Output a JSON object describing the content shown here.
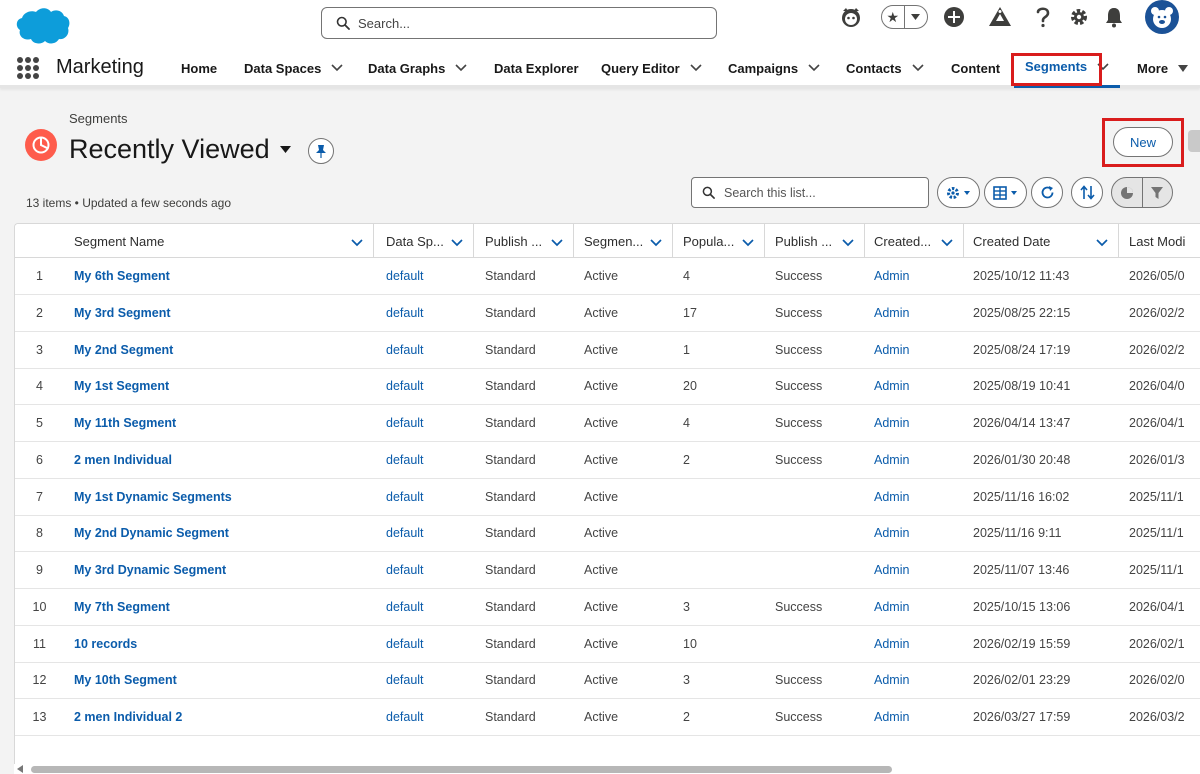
{
  "global": {
    "search_placeholder": "Search..."
  },
  "nav": {
    "app_name": "Marketing",
    "items": [
      {
        "label": "Home",
        "chevron": false
      },
      {
        "label": "Data Spaces",
        "chevron": true
      },
      {
        "label": "Data Graphs",
        "chevron": true
      },
      {
        "label": "Data Explorer",
        "chevron": false
      },
      {
        "label": "Query Editor",
        "chevron": true
      },
      {
        "label": "Campaigns",
        "chevron": true
      },
      {
        "label": "Contacts",
        "chevron": true
      },
      {
        "label": "Content",
        "chevron": false
      },
      {
        "label": "Segments",
        "chevron": true,
        "active": true
      },
      {
        "label": "More",
        "chevron": true
      }
    ]
  },
  "page": {
    "object_label": "Segments",
    "list_title": "Recently Viewed",
    "new_label": "New",
    "meta": "13 items • Updated a few seconds ago",
    "search_placeholder": "Search this list..."
  },
  "table": {
    "headers": [
      "Segment Name",
      "Data Sp...",
      "Publish ...",
      "Segmen...",
      "Popula...",
      "Publish ...",
      "Created...",
      "Created Date",
      "Last Modi"
    ],
    "rows": [
      {
        "n": "1",
        "name": "My 6th Segment",
        "space": "default",
        "publish_type": "Standard",
        "status": "Active",
        "population": "4",
        "publish_status": "Success",
        "created_by": "Admin",
        "created_date": "2025/10/12 11:43",
        "last_modified": "2026/05/0"
      },
      {
        "n": "2",
        "name": "My 3rd Segment",
        "space": "default",
        "publish_type": "Standard",
        "status": "Active",
        "population": "17",
        "publish_status": "Success",
        "created_by": "Admin",
        "created_date": "2025/08/25 22:15",
        "last_modified": "2026/02/2"
      },
      {
        "n": "3",
        "name": "My 2nd Segment",
        "space": "default",
        "publish_type": "Standard",
        "status": "Active",
        "population": "1",
        "publish_status": "Success",
        "created_by": "Admin",
        "created_date": "2025/08/24 17:19",
        "last_modified": "2026/02/2"
      },
      {
        "n": "4",
        "name": "My 1st Segment",
        "space": "default",
        "publish_type": "Standard",
        "status": "Active",
        "population": "20",
        "publish_status": "Success",
        "created_by": "Admin",
        "created_date": "2025/08/19 10:41",
        "last_modified": "2026/04/0"
      },
      {
        "n": "5",
        "name": "My 11th Segment",
        "space": "default",
        "publish_type": "Standard",
        "status": "Active",
        "population": "4",
        "publish_status": "Success",
        "created_by": "Admin",
        "created_date": "2026/04/14 13:47",
        "last_modified": "2026/04/1"
      },
      {
        "n": "6",
        "name": "2 men Individual",
        "space": "default",
        "publish_type": "Standard",
        "status": "Active",
        "population": "2",
        "publish_status": "Success",
        "created_by": "Admin",
        "created_date": "2026/01/30 20:48",
        "last_modified": "2026/01/3"
      },
      {
        "n": "7",
        "name": "My 1st Dynamic Segments",
        "space": "default",
        "publish_type": "Standard",
        "status": "Active",
        "population": "",
        "publish_status": "",
        "created_by": "Admin",
        "created_date": "2025/11/16 16:02",
        "last_modified": "2025/11/1"
      },
      {
        "n": "8",
        "name": "My 2nd Dynamic Segment",
        "space": "default",
        "publish_type": "Standard",
        "status": "Active",
        "population": "",
        "publish_status": "",
        "created_by": "Admin",
        "created_date": "2025/11/16 9:11",
        "last_modified": "2025/11/1"
      },
      {
        "n": "9",
        "name": "My 3rd Dynamic Segment",
        "space": "default",
        "publish_type": "Standard",
        "status": "Active",
        "population": "",
        "publish_status": "",
        "created_by": "Admin",
        "created_date": "2025/11/07 13:46",
        "last_modified": "2025/11/1"
      },
      {
        "n": "10",
        "name": "My 7th Segment",
        "space": "default",
        "publish_type": "Standard",
        "status": "Active",
        "population": "3",
        "publish_status": "Success",
        "created_by": "Admin",
        "created_date": "2025/10/15 13:06",
        "last_modified": "2026/04/1"
      },
      {
        "n": "11",
        "name": "10 records",
        "space": "default",
        "publish_type": "Standard",
        "status": "Active",
        "population": "10",
        "publish_status": "",
        "created_by": "Admin",
        "created_date": "2026/02/19 15:59",
        "last_modified": "2026/02/1"
      },
      {
        "n": "12",
        "name": "My 10th Segment",
        "space": "default",
        "publish_type": "Standard",
        "status": "Active",
        "population": "3",
        "publish_status": "Success",
        "created_by": "Admin",
        "created_date": "2026/02/01 23:29",
        "last_modified": "2026/02/0"
      },
      {
        "n": "13",
        "name": "2 men Individual 2",
        "space": "default",
        "publish_type": "Standard",
        "status": "Active",
        "population": "2",
        "publish_status": "Success",
        "created_by": "Admin",
        "created_date": "2026/03/27 17:59",
        "last_modified": "2026/03/2"
      }
    ]
  },
  "colors": {
    "brand_blue": "#0b5cab",
    "segment_icon": "#fe5c4c",
    "highlight_red": "#d91c1c",
    "cloud_blue": "#0d9dda"
  },
  "icons": [
    "salesforce-cloud-logo",
    "search-icon",
    "astro-icon",
    "favorites-star-icon",
    "add-icon",
    "trailhead-icon",
    "help-icon",
    "setup-gear-icon",
    "notification-bell-icon",
    "user-avatar-icon",
    "app-launcher-icon",
    "chevron-down-icon",
    "segment-object-icon",
    "pin-icon",
    "settings-icon",
    "display-as-table-icon",
    "refresh-icon",
    "sort-icon",
    "chart-icon",
    "filter-icon"
  ]
}
